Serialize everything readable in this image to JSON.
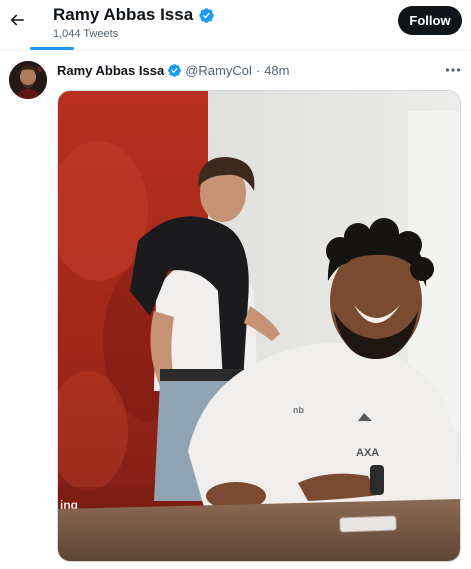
{
  "header": {
    "display_name": "Ramy Abbas Issa",
    "tweet_count": "1,044 Tweets",
    "follow_label": "Follow"
  },
  "tweet": {
    "author_name": "Ramy Abbas Issa",
    "handle": "@RamyCol",
    "separator": "·",
    "time": "48m"
  },
  "media": {
    "kind": "video-gif",
    "overlay_text": "ing"
  },
  "icons": {
    "back": "back-arrow-icon",
    "verified": "verified-badge-icon",
    "more": "more-dots-icon"
  },
  "colors": {
    "accent": "#1d9bf0",
    "follow_bg": "#0f1419",
    "secondary_text": "#536471"
  }
}
